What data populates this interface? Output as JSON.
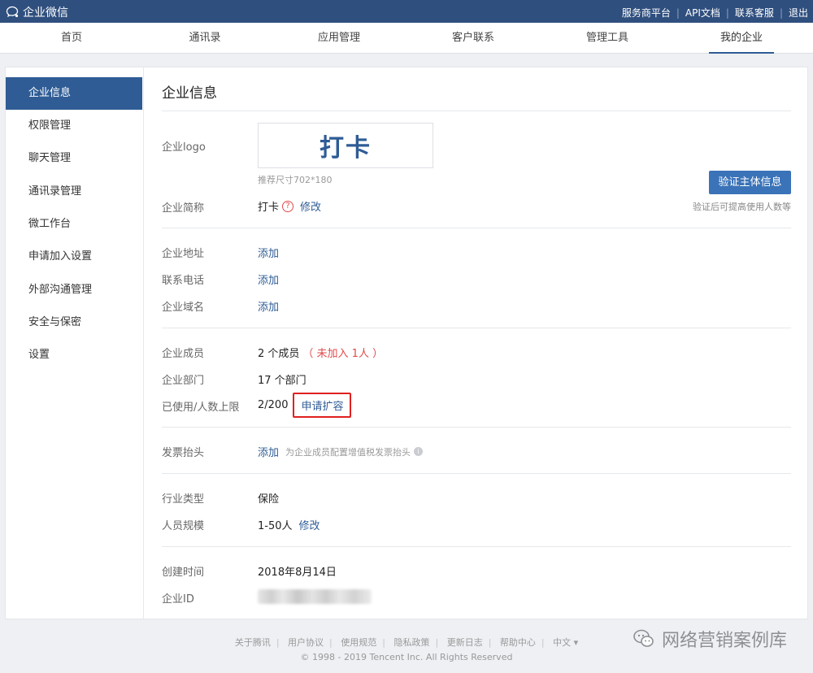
{
  "topbar": {
    "brand": "企业微信",
    "links": [
      "服务商平台",
      "API文档",
      "联系客服",
      "退出"
    ]
  },
  "nav": {
    "items": [
      "首页",
      "通讯录",
      "应用管理",
      "客户联系",
      "管理工具",
      "我的企业"
    ],
    "active_index": 5
  },
  "sidebar": {
    "items": [
      "企业信息",
      "权限管理",
      "聊天管理",
      "通讯录管理",
      "微工作台",
      "申请加入设置",
      "外部沟通管理",
      "安全与保密",
      "设置"
    ],
    "active_index": 0
  },
  "main": {
    "title": "企业信息",
    "logo": {
      "label": "企业logo",
      "image_text": "打卡",
      "hint": "推荐尺寸702*180"
    },
    "verify": {
      "button": "验证主体信息",
      "hint": "验证后可提高使用人数等"
    },
    "short_name": {
      "label": "企业简称",
      "value": "打卡",
      "help": "?",
      "edit": "修改"
    },
    "address": {
      "label": "企业地址",
      "action": "添加"
    },
    "phone": {
      "label": "联系电话",
      "action": "添加"
    },
    "domain": {
      "label": "企业域名",
      "action": "添加"
    },
    "members": {
      "label": "企业成员",
      "value": "2 个成员",
      "pending": "（ 未加入 1人 ）"
    },
    "departments": {
      "label": "企业部门",
      "value": "17 个部门"
    },
    "usage": {
      "label": "已使用/人数上限",
      "value": "2/200",
      "expand": "申请扩容"
    },
    "invoice": {
      "label": "发票抬头",
      "action": "添加",
      "hint": "为企业成员配置增值税发票抬头",
      "info": "i"
    },
    "industry": {
      "label": "行业类型",
      "value": "保险"
    },
    "scale": {
      "label": "人员规模",
      "value": "1-50人",
      "edit": "修改"
    },
    "created": {
      "label": "创建时间",
      "value": "2018年8月14日"
    },
    "corp_id": {
      "label": "企业ID"
    }
  },
  "footer": {
    "links": [
      "关于腾讯",
      "用户协议",
      "使用规范",
      "隐私政策",
      "更新日志",
      "帮助中心",
      "中文 ▾"
    ],
    "copyright": "© 1998 - 2019 Tencent Inc. All Rights Reserved"
  },
  "watermark": {
    "text": "网络营销案例库"
  },
  "colors": {
    "topbar": "#2f4f7e",
    "accent": "#2f5c95",
    "button": "#3a73b8",
    "highlight": "#e02020",
    "warning": "#e14b4b"
  }
}
